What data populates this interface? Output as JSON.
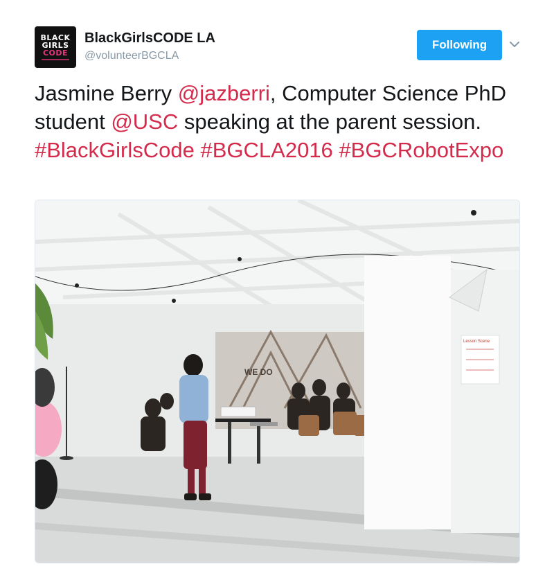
{
  "account": {
    "display_name": "BlackGirlsCODE LA",
    "handle": "@volunteerBGCLA",
    "avatar": {
      "line1": "BLACK",
      "line2": "GIRLS",
      "line3": "CODE"
    }
  },
  "follow_button": {
    "label": "Following"
  },
  "tweet": {
    "parts": [
      {
        "text": "Jasmine Berry ",
        "type": "text"
      },
      {
        "text": "@jazberri",
        "type": "mention"
      },
      {
        "text": ", Computer Science PhD student ",
        "type": "text"
      },
      {
        "text": "@USC",
        "type": "mention"
      },
      {
        "text": " speaking at the parent session. ",
        "type": "text"
      },
      {
        "text": "#BlackGirlsCode",
        "type": "hashtag"
      },
      {
        "text": " ",
        "type": "text"
      },
      {
        "text": "#BGCLA2016",
        "type": "hashtag"
      },
      {
        "text": " ",
        "type": "text"
      },
      {
        "text": "#BGCRobotExpo",
        "type": "hashtag"
      }
    ]
  },
  "photo": {
    "wall_sign_text": "WE DO",
    "board_title": "Lesson Scene"
  },
  "colors": {
    "link": "#d42b4c",
    "follow_button": "#1da1f2",
    "text": "#14171a",
    "secondary_text": "#8899a6"
  }
}
